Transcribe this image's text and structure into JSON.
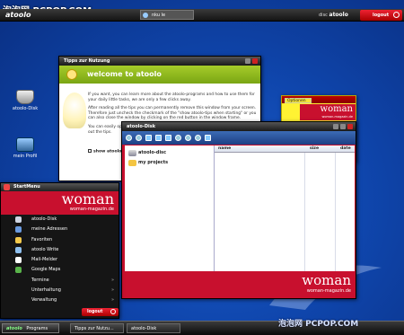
{
  "watermark": {
    "top": "泡泡网 PCPOP.COM",
    "bottom": "泡泡网 PCPOP.COM"
  },
  "topbar": {
    "logo": "atoolo",
    "user": "nku le",
    "disk_prefix": "disc",
    "disk_brand": "atoolo",
    "logout": "logout"
  },
  "desktop_icons": [
    {
      "label": "atoolo-Disk"
    },
    {
      "label": "mein Profil"
    }
  ],
  "tips_window": {
    "title": "Tipps zur Nutzung",
    "banner": "welcome to atoolo",
    "paragraphs": [
      "If you want, you can learn more about the atoolo-programs and how to use them for your daily little tasks, we are only a few clicks away.",
      "After reading all the tips you can permanently remove this window from your screen. Therefore just uncheck the checkmark of the \"show atoolo-tips when starting\" or you can also close the window by clicking on the red button in the window frame.",
      "You can easily open this window again by clicking on the lightbulb reading and trying out the tips."
    ],
    "checkbox_label": "show atoolo-tips when starting"
  },
  "sticky_note": {
    "options": "Optionen",
    "brand": "woman",
    "brand_sub": "woman-magazin.de",
    "date": "Apr 10:00"
  },
  "disk_window": {
    "title": "atoolo-Disk",
    "tree": [
      {
        "label": "atoolo-disc"
      },
      {
        "label": "my projects"
      }
    ],
    "columns": [
      "name",
      "size",
      "date"
    ],
    "brand": "woman",
    "brand_sub": "woman-magazin.de"
  },
  "start_menu": {
    "title": "StartMenu",
    "brand": "woman",
    "brand_sub": "woman-magazin.de",
    "items": [
      {
        "label": "atoolo-Disk",
        "color": "#cfd6e4",
        "submenu": false
      },
      {
        "label": "meine Adressen",
        "color": "#6a9be0",
        "submenu": false
      },
      {
        "label": "Favoriten",
        "color": "#f2c94c",
        "submenu": false
      },
      {
        "label": "atoolo Write",
        "color": "#8fc0ef",
        "submenu": false
      },
      {
        "label": "Mail-Melder",
        "color": "#ffffff",
        "submenu": false
      },
      {
        "label": "Google Maps",
        "color": "#59b34a",
        "submenu": false
      },
      {
        "label": "Termine",
        "color": "#151515",
        "submenu": true
      },
      {
        "label": "Unterhaltung",
        "color": "#151515",
        "submenu": true
      },
      {
        "label": "Verwaltung",
        "color": "#151515",
        "submenu": true
      }
    ],
    "logout": "logout"
  },
  "taskbar": {
    "start_logo": "atoolo",
    "start_label": "Programs",
    "tasks": [
      {
        "label": "Tipps zur Nutzu..."
      },
      {
        "label": "atoolo-Disk"
      }
    ]
  },
  "colors": {
    "desktop": "#0f46ad",
    "brand_red": "#c8102e",
    "tips_green": "#8ab81c",
    "note_yellow": "#fff233"
  }
}
